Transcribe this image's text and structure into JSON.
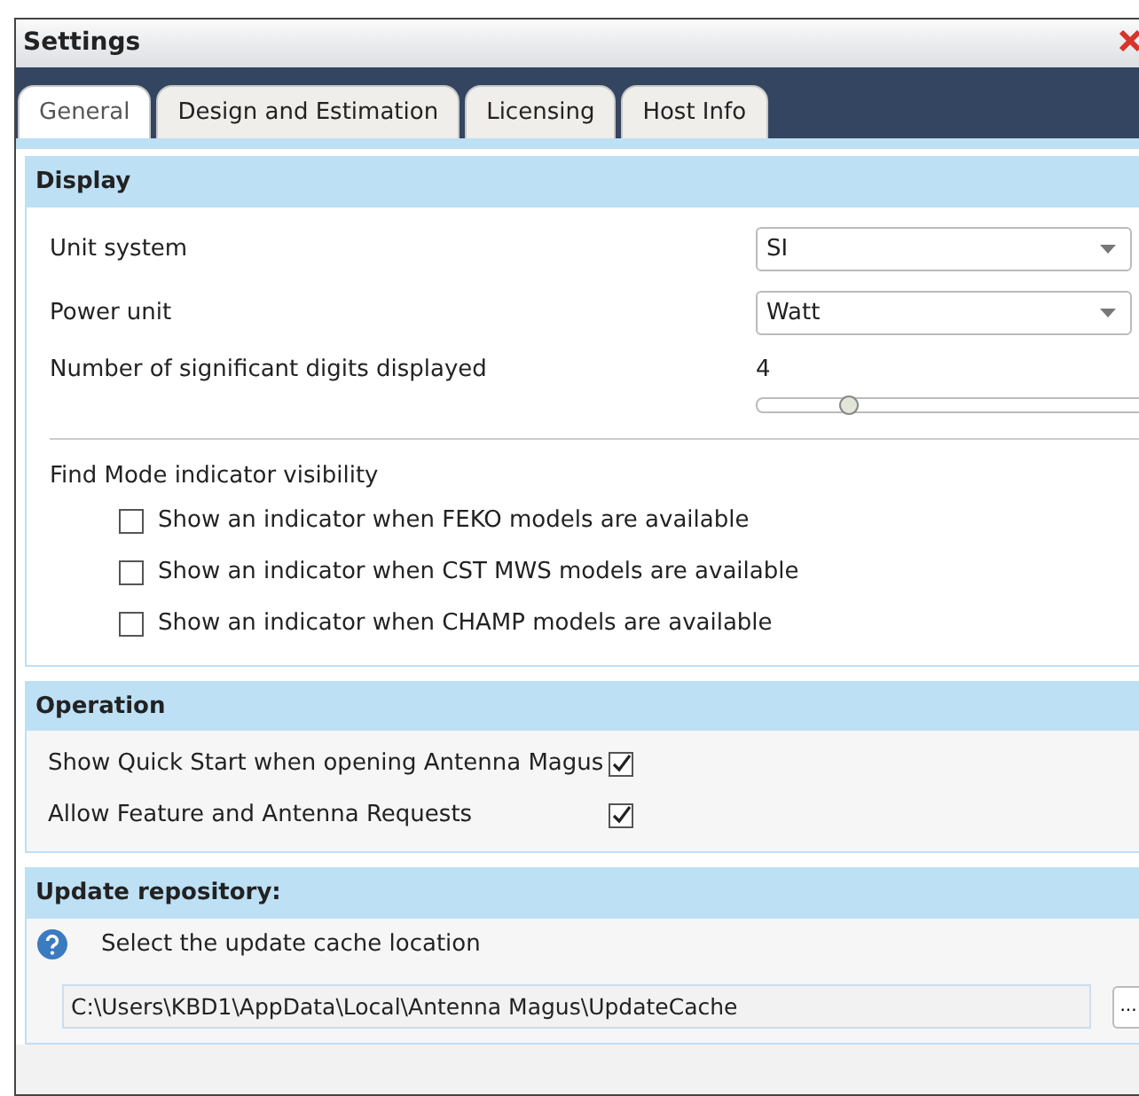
{
  "window": {
    "title": "Settings"
  },
  "tabs": [
    {
      "label": "General",
      "selected": true
    },
    {
      "label": "Design and Estimation",
      "selected": false
    },
    {
      "label": "Licensing",
      "selected": false
    },
    {
      "label": "Host Info",
      "selected": false
    }
  ],
  "display": {
    "title": "Display",
    "settings": [
      {
        "kind": "dropdown",
        "label": "Unit system",
        "value": "SI"
      },
      {
        "kind": "dropdown",
        "label": "Power unit",
        "value": "Watt"
      },
      {
        "kind": "slider",
        "label": "Number of significant digits displayed",
        "reading": "4",
        "level": 0.2
      }
    ],
    "find_mode": {
      "label": "Find Mode indicator visibility",
      "options": [
        {
          "label": "Show an indicator when FEKO models are available",
          "checked": false
        },
        {
          "label": "Show an indicator when CST MWS models are available",
          "checked": false
        },
        {
          "label": "Show an indicator when CHAMP models are available",
          "checked": false
        }
      ]
    }
  },
  "operation": {
    "title": "Operation",
    "options": [
      {
        "label": "Show Quick Start when opening Antenna Magus",
        "checked": true
      },
      {
        "label": "Allow Feature and Antenna Requests",
        "checked": true
      }
    ]
  },
  "update_repository": {
    "title": "Update repository:",
    "hint": "Select the update cache location",
    "path": "C:\\Users\\KBD1\\AppData\\Local\\Antenna Magus\\UpdateCache",
    "browse_button": "..."
  }
}
